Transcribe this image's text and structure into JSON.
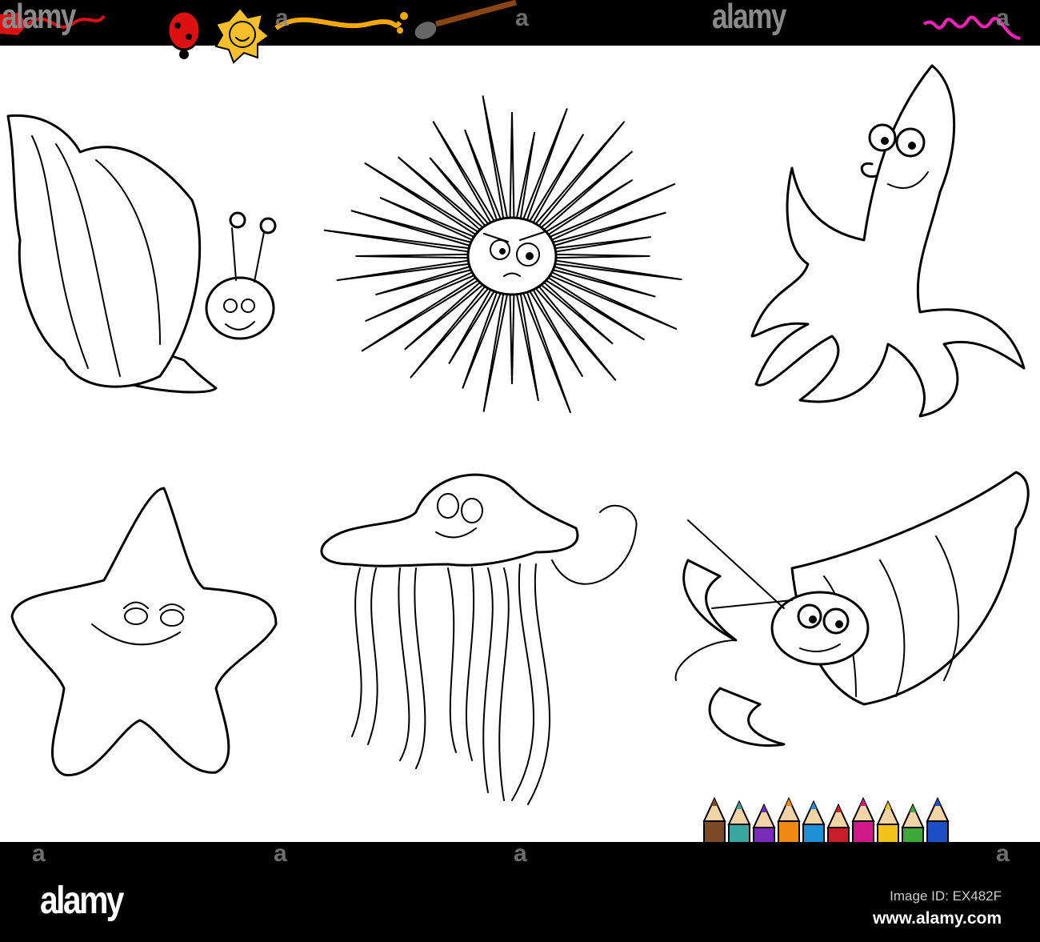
{
  "watermark": {
    "brand": "alamy",
    "letter": "a"
  },
  "footer": {
    "logo": "alamy",
    "image_id": "Image ID: EX482F",
    "url": "www.alamy.com"
  },
  "illustrations": [
    "sea snail",
    "sea urchin",
    "octopus",
    "starfish",
    "jellyfish",
    "hermit crab"
  ],
  "pencil_colors": [
    "#7b4a26",
    "#3aa6a0",
    "#7a2ab8",
    "#f08a12",
    "#1e8fd6",
    "#c81e2a",
    "#d01a8a",
    "#f2c21a",
    "#3fa63a",
    "#1f4fc4"
  ]
}
